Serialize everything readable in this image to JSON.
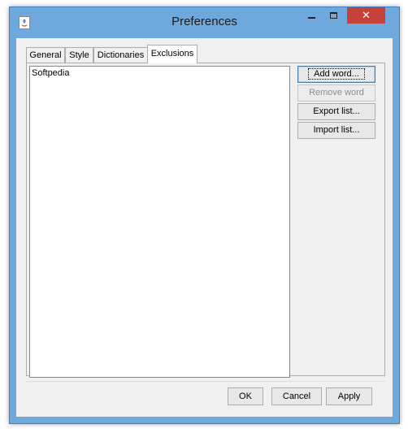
{
  "window": {
    "title": "Preferences",
    "controls": {
      "minimize_icon": "minimize-icon",
      "maximize_icon": "maximize-icon",
      "close_glyph": "✕"
    }
  },
  "tabs": [
    {
      "label": "General",
      "active": false
    },
    {
      "label": "Style",
      "active": false
    },
    {
      "label": "Dictionaries",
      "active": false
    },
    {
      "label": "Exclusions",
      "active": true
    }
  ],
  "exclusions": {
    "words": [
      "Softpedia"
    ],
    "buttons": {
      "add": "Add word...",
      "remove": "Remove word",
      "export": "Export list...",
      "import": "Import list..."
    }
  },
  "footer": {
    "ok": "OK",
    "cancel": "Cancel",
    "apply": "Apply"
  },
  "colors": {
    "titlebar": "#6fa8dc",
    "close_button": "#c7413b",
    "dialog_bg": "#f0f0f0"
  }
}
